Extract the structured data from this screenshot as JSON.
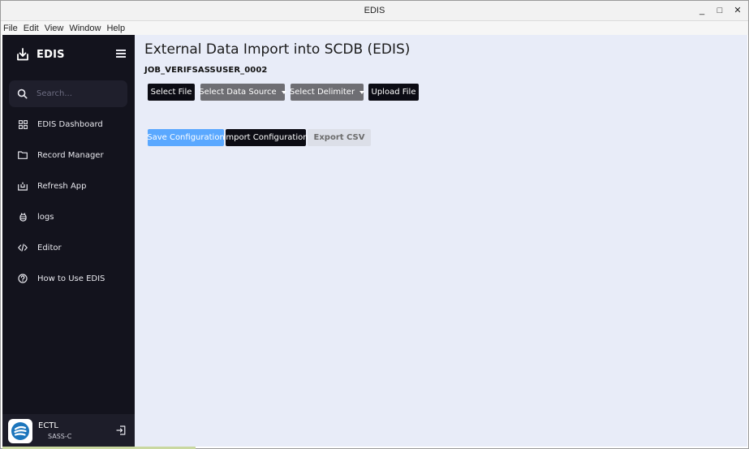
{
  "window": {
    "title": "EDIS",
    "minimize": "_",
    "maximize": "□",
    "close": "✕"
  },
  "menu": [
    "File",
    "Edit",
    "View",
    "Window",
    "Help"
  ],
  "sidebar": {
    "brand": "EDIS",
    "search_placeholder": "Search...",
    "items": [
      {
        "label": "EDIS Dashboard",
        "icon": "grid-icon"
      },
      {
        "label": "Record Manager",
        "icon": "folder-icon"
      },
      {
        "label": "Refresh App",
        "icon": "refresh-icon"
      },
      {
        "label": "logs",
        "icon": "bug-icon"
      },
      {
        "label": "Editor",
        "icon": "code-icon"
      },
      {
        "label": "How to Use EDIS",
        "icon": "help-icon"
      }
    ],
    "user": {
      "name": "ECTL",
      "role": "SASS-C"
    }
  },
  "main": {
    "title": "External Data Import into SCDB (EDIS)",
    "job_id": "JOB_VERIFSASSUSER_0002",
    "toolbar": {
      "select_file": "Select File",
      "select_data_source": "Select Data Source",
      "select_delimiter": "Select Delimiter",
      "upload_file": "Upload File"
    },
    "config": {
      "save": "Save Configuration",
      "import": "Import Configuration",
      "export": "Export CSV"
    }
  },
  "colors": {
    "sidebar_bg": "#13131d",
    "main_bg": "#e8ecf8",
    "primary_dark": "#0c0c14",
    "secondary_gray": "#6e6e73",
    "accent_blue": "#5aa8ff"
  }
}
